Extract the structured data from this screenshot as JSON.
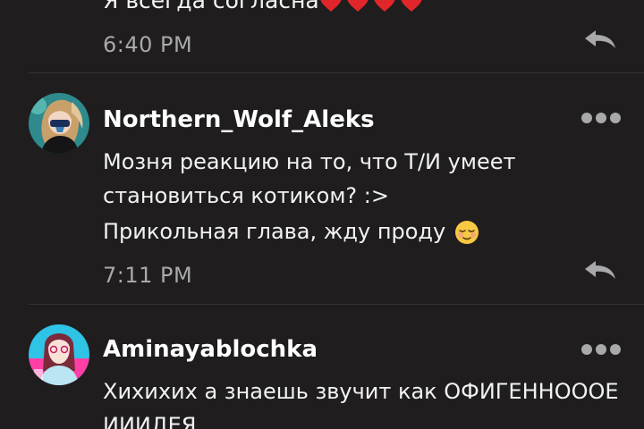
{
  "comments": [
    {
      "text": "Я всегда согласна",
      "emoji": "red-heart-icon",
      "heart_count": 4,
      "time": "6:40 PM"
    },
    {
      "username": "Northern_Wolf_Aleks",
      "avatar_icon": "anime-girl-avatar",
      "lines": [
        "Мозня реакцию на то, что Т/И умеет",
        "становиться котиком? :>",
        "Прикольная глава, жду проду"
      ],
      "emoji": "relieved-face-icon",
      "time": "7:11 PM"
    },
    {
      "username": "Aminayablochka",
      "avatar_icon": "anime-girl-avatar",
      "lines": [
        "Хихихих а знаешь звучит как ОФИГЕННОООЕ",
        "ИИИДЕЯ"
      ]
    }
  ],
  "colors": {
    "background": "#1f1d1e",
    "text": "#f2f2f2",
    "muted": "#a9a8ab",
    "divider": "#343234"
  }
}
